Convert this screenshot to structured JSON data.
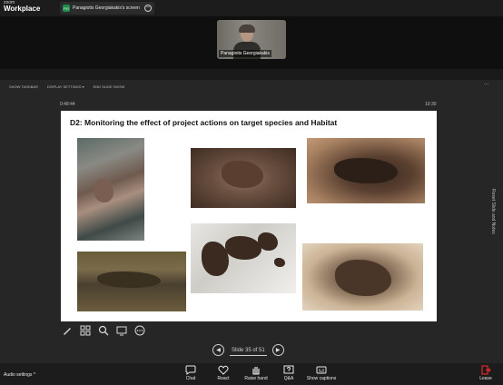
{
  "app": {
    "logo_top": "zoom",
    "logo_bottom": "Workplace",
    "share_initials": "PG",
    "share_tab_label": "Panagiotis Georgiakakis's screen"
  },
  "participant": {
    "name": "Panagiotis Georgiakakis"
  },
  "ppt_toolbar": {
    "show_taskbar": "SHOW TASKBAR",
    "display_settings": "DISPLAY SETTINGS ▾",
    "end_slide_show": "END SLIDE SHOW",
    "more": "..."
  },
  "presenter": {
    "timer": "0:48:44",
    "clock": "10:30",
    "side_label": "Reset Slide and Notes"
  },
  "slide": {
    "title": "D2: Monitoring the effect of project actions on target species and Habitat"
  },
  "navigation": {
    "prev": "◀",
    "counter": "Slide 35 of 51",
    "next": "▶"
  },
  "bottombar": {
    "audio_settings": "Audio settings ^",
    "items": [
      {
        "label": "Chat"
      },
      {
        "label": "React"
      },
      {
        "label": "Raise hand"
      },
      {
        "label": "Q&A"
      },
      {
        "label": "Show captions"
      }
    ],
    "leave": "Leave"
  },
  "colors": {
    "topbar": "#1c1c1c",
    "background": "#1a1a1a",
    "leave_red": "#e02828",
    "share_green": "#1f8c4e"
  }
}
